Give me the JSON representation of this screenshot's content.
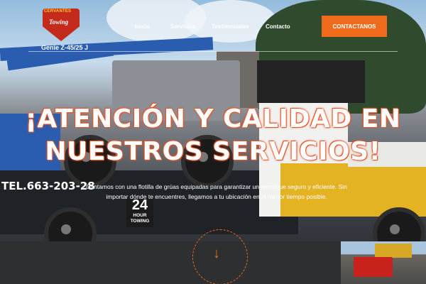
{
  "logo": {
    "top_text": "CERVANTES",
    "main_text": "Towing",
    "icon": "cervantes-towing-logo"
  },
  "nav": {
    "items": [
      {
        "label": "Inicio"
      },
      {
        "label": "Servicios"
      },
      {
        "label": "Testimoniales"
      },
      {
        "label": "Contacto"
      }
    ],
    "cta_label": "CONTACTANOS",
    "cta_icon": "arrow-right-icon"
  },
  "hero": {
    "headline_line1": "¡ATENCIÓN Y CALIDAD EN",
    "headline_line2": "NUESTROS SERVICIOS!",
    "subtext": "Contamos con una flotilla de grúas equipadas para garantizar un remolque seguro y eficiente. Sin importar dónde te encuentres, llegamos a tu ubicación en el menor tiempo posible.",
    "scroll_icon": "arrow-down-icon"
  },
  "scene_text": {
    "phone": "TEL.663-203-28",
    "lift_brand": "Genie Z-45/25 J",
    "badge_number": "24",
    "badge_hours": "HOUR",
    "badge_towing": "TOWING"
  },
  "colors": {
    "accent": "#f06a1c",
    "headline_glow": "#e6562a",
    "text": "#ffffff"
  }
}
